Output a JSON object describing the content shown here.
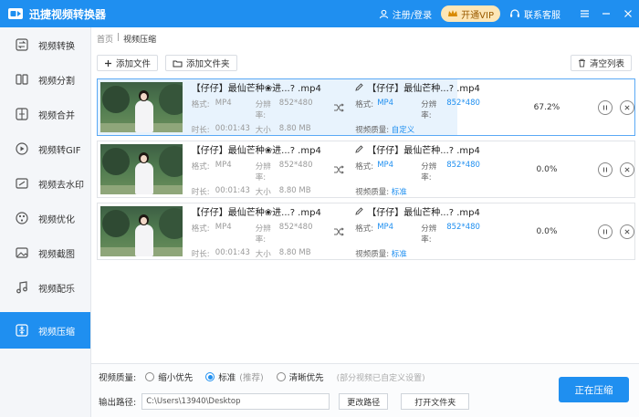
{
  "app": {
    "title": "迅捷视频转换器",
    "login": "注册/登录",
    "vip": "开通VIP",
    "service": "联系客服"
  },
  "sidebar": {
    "items": [
      {
        "label": "视频转换",
        "icon": "convert-icon"
      },
      {
        "label": "视频分割",
        "icon": "split-icon"
      },
      {
        "label": "视频合并",
        "icon": "merge-icon"
      },
      {
        "label": "视频转GIF",
        "icon": "gif-icon"
      },
      {
        "label": "视频去水印",
        "icon": "watermark-icon"
      },
      {
        "label": "视频优化",
        "icon": "optimize-icon"
      },
      {
        "label": "视频截图",
        "icon": "screenshot-icon"
      },
      {
        "label": "视频配乐",
        "icon": "music-icon"
      },
      {
        "label": "视频压缩",
        "icon": "compress-icon",
        "active": true
      }
    ]
  },
  "breadcrumb": {
    "home": "首页",
    "sep": "|",
    "current": "视频压缩"
  },
  "toolbar": {
    "add_file": "添加文件",
    "add_folder": "添加文件夹",
    "clear": "清空列表"
  },
  "labels": {
    "format": "格式:",
    "resolution": "分辨率:",
    "duration": "时长:",
    "size": "大小",
    "quality": "视频质量:"
  },
  "files": [
    {
      "name": "【仔仔】最仙芒种❀进...? .mp4",
      "format": "MP4",
      "resolution": "852*480",
      "duration": "00:01:43",
      "size": "8.80 MB",
      "out_name": "【仔仔】最仙芒种...? .mp4",
      "out_format": "MP4",
      "out_resolution": "852*480",
      "out_quality": "自定义",
      "percent": "67.2%",
      "progress": 0.67
    },
    {
      "name": "【仔仔】最仙芒种❀进...? .mp4",
      "format": "MP4",
      "resolution": "852*480",
      "duration": "00:01:43",
      "size": "8.80 MB",
      "out_name": "【仔仔】最仙芒种...? .mp4",
      "out_format": "MP4",
      "out_resolution": "852*480",
      "out_quality": "标准",
      "percent": "0.0%",
      "progress": 0
    },
    {
      "name": "【仔仔】最仙芒种❀进...? .mp4",
      "format": "MP4",
      "resolution": "852*480",
      "duration": "00:01:43",
      "size": "8.80 MB",
      "out_name": "【仔仔】最仙芒种...? .mp4",
      "out_format": "MP4",
      "out_resolution": "852*480",
      "out_quality": "标准",
      "percent": "0.0%",
      "progress": 0
    }
  ],
  "bottom": {
    "quality_label": "视频质量:",
    "opt_small": "缩小优先",
    "opt_standard": "标准",
    "opt_standard_note": "(推荐)",
    "opt_clear": "清晰优先",
    "note": "(部分视频已自定义设置)",
    "path_label": "输出路径:",
    "path_value": "C:\\Users\\13940\\Desktop",
    "change_path": "更改路径",
    "open_folder": "打开文件夹",
    "start": "正在压缩"
  },
  "colors": {
    "accent": "#1f8ff0",
    "progress_bg": "#e8f3fd",
    "vip_bg": "#fde6b6"
  }
}
